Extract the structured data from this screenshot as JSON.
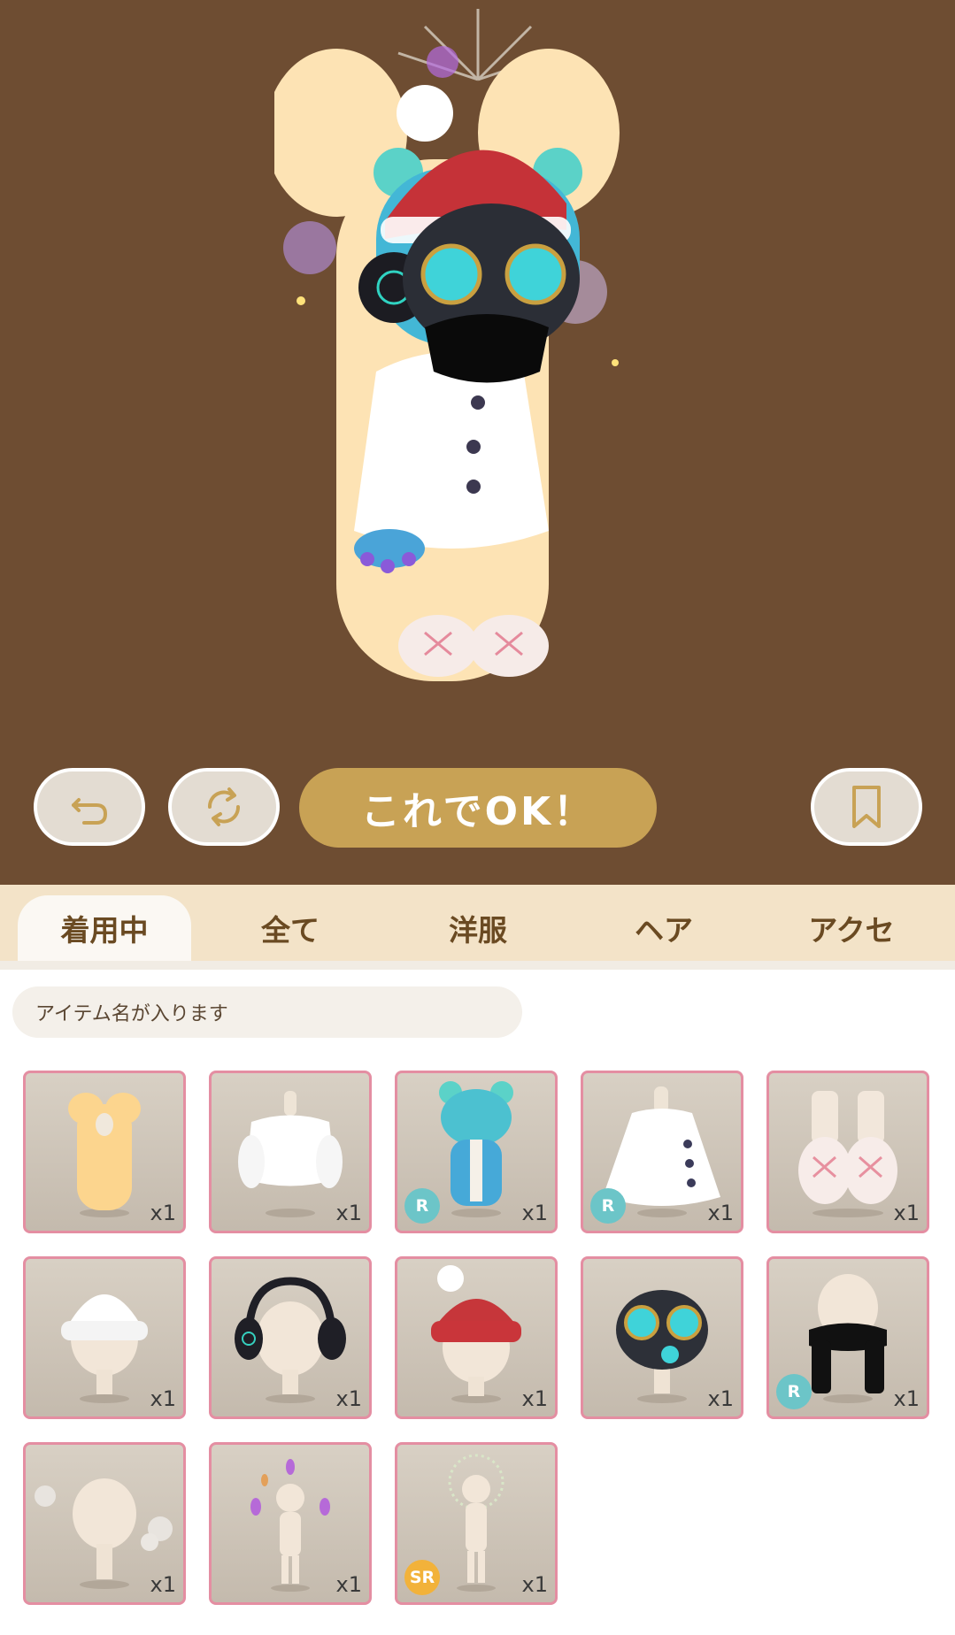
{
  "controls": {
    "undo_icon": "undo-arrow-icon",
    "rotate_icon": "rotate-icon",
    "ok_label": "これでOK！",
    "bookmark_icon": "bookmark-icon"
  },
  "colors": {
    "stage_bg": "#6e4d32",
    "accent_gold": "#c8a255",
    "tab_bar": "#f3e3c8",
    "card_border": "#e48ea2",
    "badge_r": "#6cc5c8",
    "badge_sr": "#f2b23a"
  },
  "tabs": [
    {
      "label": "着用中",
      "active": true
    },
    {
      "label": "全て",
      "active": false
    },
    {
      "label": "洋服",
      "active": false
    },
    {
      "label": "ヘア",
      "active": false
    },
    {
      "label": "アクセ",
      "active": false
    }
  ],
  "item_name_placeholder": "アイテム名が入ります",
  "items": [
    {
      "icon": "bear-body-icon",
      "quantity": "x1",
      "rarity": ""
    },
    {
      "icon": "white-fur-jacket-icon",
      "quantity": "x1",
      "rarity": ""
    },
    {
      "icon": "blue-bear-costume-icon",
      "quantity": "x1",
      "rarity": "R"
    },
    {
      "icon": "white-coat-icon",
      "quantity": "x1",
      "rarity": "R"
    },
    {
      "icon": "fur-boots-icon",
      "quantity": "x1",
      "rarity": ""
    },
    {
      "icon": "white-knit-hat-icon",
      "quantity": "x1",
      "rarity": ""
    },
    {
      "icon": "headphones-icon",
      "quantity": "x1",
      "rarity": ""
    },
    {
      "icon": "red-beanie-icon",
      "quantity": "x1",
      "rarity": ""
    },
    {
      "icon": "gas-mask-icon",
      "quantity": "x1",
      "rarity": ""
    },
    {
      "icon": "black-scarf-icon",
      "quantity": "x1",
      "rarity": "R"
    },
    {
      "icon": "smoke-effect-icon",
      "quantity": "x1",
      "rarity": ""
    },
    {
      "icon": "flame-aura-icon",
      "quantity": "x1",
      "rarity": ""
    },
    {
      "icon": "halo-effect-icon",
      "quantity": "x1",
      "rarity": "SR"
    }
  ]
}
